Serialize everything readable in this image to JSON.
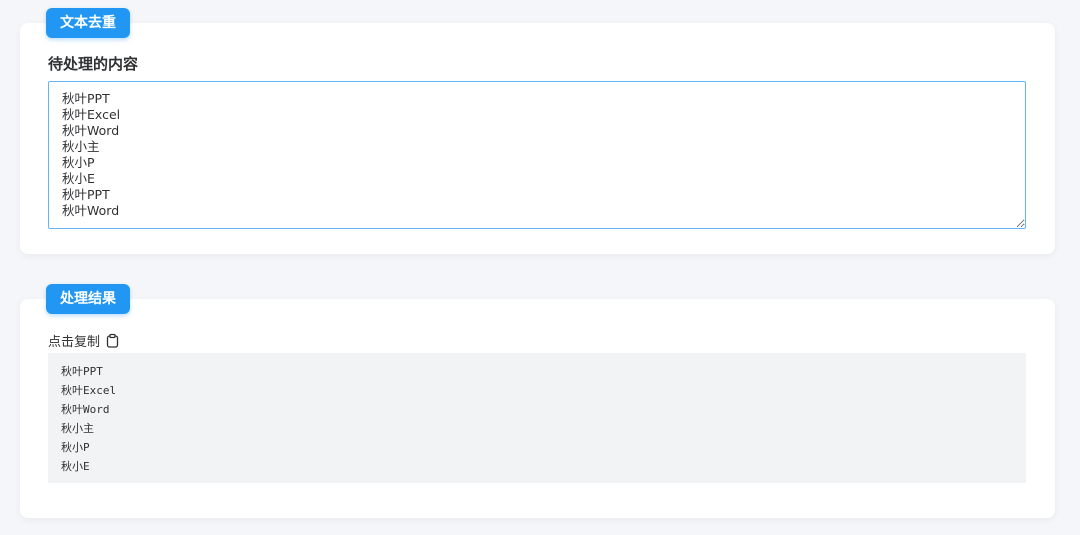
{
  "theme": {
    "accent": "#2196f3",
    "page_background": "#f4f6f9",
    "card_background": "#ffffff",
    "input_border": "#64b5f6",
    "result_background": "#f1f3f5"
  },
  "input_section": {
    "badge": "文本去重",
    "label": "待处理的内容",
    "content": "秋叶PPT\n秋叶Excel\n秋叶Word\n秋小主\n秋小P\n秋小E\n秋叶PPT\n秋叶Word"
  },
  "output_section": {
    "badge": "处理结果",
    "copy_label": "点击复制",
    "copy_icon": "clipboard-icon",
    "result_lines": [
      "秋叶PPT",
      "秋叶Excel",
      "秋叶Word",
      "秋小主",
      "秋小P",
      "秋小E"
    ]
  }
}
